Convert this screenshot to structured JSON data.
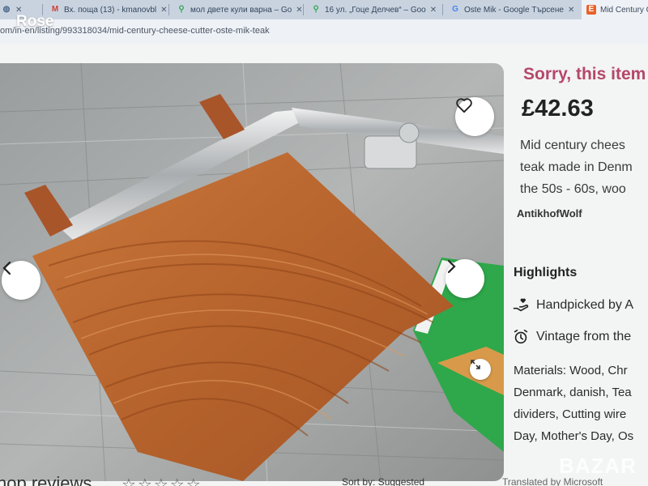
{
  "browser": {
    "tabs": [
      {
        "label": "",
        "icon": "globe-icon"
      },
      {
        "label": "Вх. поща (13) - kmanovbl",
        "icon": "gmail-icon"
      },
      {
        "label": "мол двете кули варна – Go",
        "icon": "maps-icon"
      },
      {
        "label": "16 ул. „Гоце Делчев“ – Goo",
        "icon": "maps-icon"
      },
      {
        "label": "Oste Mik - Google Търсене",
        "icon": "google-icon"
      },
      {
        "label": "Mid Century Ch",
        "icon": "etsy-icon"
      }
    ],
    "url": "om/in-en/listing/993318034/mid-century-cheese-cutter-oste-mik-teak"
  },
  "listing": {
    "unavailable_text": "Sorry, this item",
    "price": "£42.63",
    "description_lines": [
      "Mid century chees",
      "teak made in Denm",
      "the 50s - 60s, woo"
    ],
    "shop_name": "AntikhofWolf",
    "highlights_title": "Highlights",
    "highlights": [
      {
        "label": "Handpicked by A",
        "icon": "hand-heart-icon"
      },
      {
        "label": "Vintage from the",
        "icon": "alarm-clock-icon"
      }
    ],
    "materials_lines": [
      "Materials: Wood, Chr",
      "Denmark, danish, Tea",
      "dividers, Cutting wire",
      "Day, Mother's Day, Os"
    ]
  },
  "gallery": {
    "favorite_icon": "heart-icon",
    "prev_icon": "chevron-left-icon",
    "next_icon": "chevron-right-icon",
    "zoom_icon": "expand-icon"
  },
  "reviews": {
    "heading": "hop reviews",
    "stars": "☆☆☆☆☆",
    "sort_label": "Sort by: Suggested",
    "translated_label": "Translated by Microsoft"
  },
  "overlays": {
    "watermark_left": "Rose",
    "watermark_right": "BAZAR"
  },
  "colors": {
    "accent_pink": "#b5476a",
    "teak": "#b8652e",
    "tab_bar": "#c9d3e0"
  }
}
